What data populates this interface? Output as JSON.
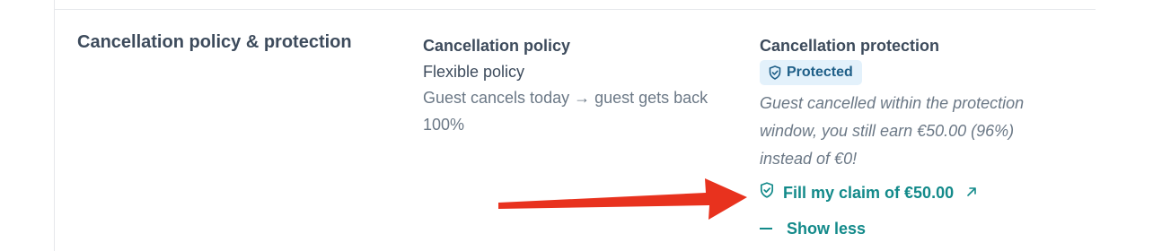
{
  "section": {
    "title": "Cancellation policy & protection"
  },
  "policy": {
    "heading": "Cancellation policy",
    "name": "Flexible policy",
    "description": "Guest cancels today → guest gets back 100%"
  },
  "protection": {
    "heading": "Cancellation protection",
    "badge_label": "Protected",
    "note": "Guest cancelled within the protection window, you still earn €50.00 (96%) instead of €0!",
    "claim_label": "Fill my claim of €50.00",
    "show_less_label": "Show less"
  },
  "icons": {
    "badge": "shield-check-icon",
    "claim": "shield-check-icon",
    "external": "arrow-up-right-icon",
    "collapse": "minus-icon",
    "annotation": "red-arrow-annotation"
  },
  "colors": {
    "accent": "#138a8a",
    "badge_bg": "#e3f1fb",
    "badge_text": "#1f5f88",
    "annotation_arrow": "#e8321e"
  }
}
